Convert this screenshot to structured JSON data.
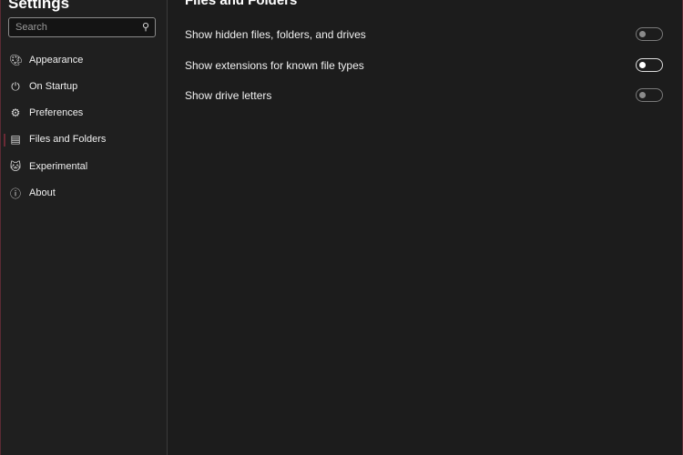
{
  "sidebar": {
    "title": "Settings",
    "search_placeholder": "Search",
    "items": [
      {
        "label": "Appearance"
      },
      {
        "label": "On Startup"
      },
      {
        "label": "Preferences"
      },
      {
        "label": "Files and Folders"
      },
      {
        "label": "Experimental"
      },
      {
        "label": "About"
      }
    ]
  },
  "main": {
    "heading": "Files and Folders",
    "settings": [
      {
        "label": "Show hidden files, folders, and drives",
        "on": false
      },
      {
        "label": "Show extensions for known file types",
        "on": false
      },
      {
        "label": "Show drive letters",
        "on": false
      }
    ]
  }
}
